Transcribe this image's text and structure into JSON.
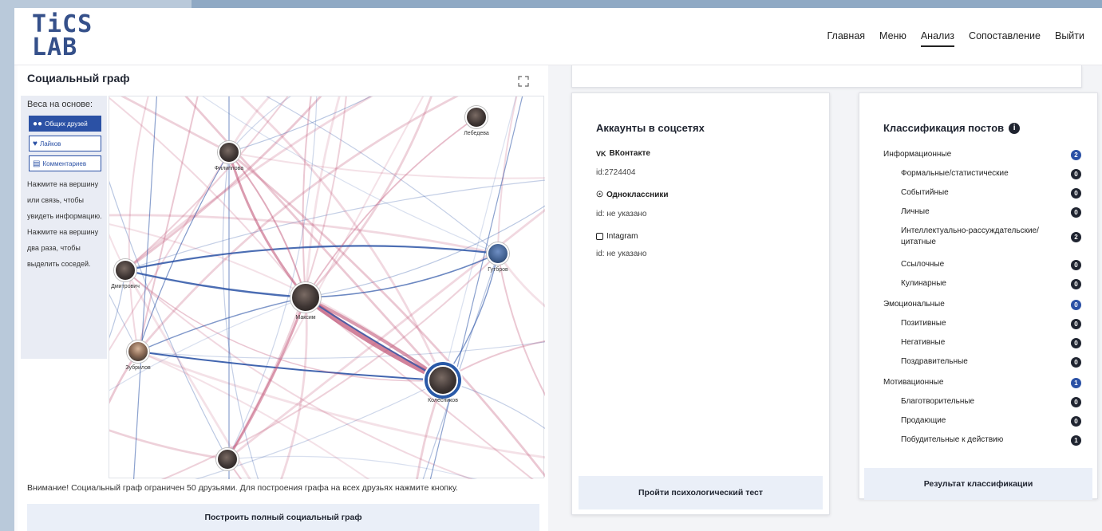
{
  "logo": {
    "line1": "TiCS",
    "line2": "LAB"
  },
  "nav": [
    "Главная",
    "Меню",
    "Анализ",
    "Сопоставление",
    "Выйти"
  ],
  "nav_active": "Анализ",
  "graph_panel": {
    "title": "Социальный граф",
    "weights_label": "Веса на основе:",
    "weight_buttons": [
      {
        "label": "Общих друзей",
        "icon": "users-icon",
        "active": true
      },
      {
        "label": "Лайков",
        "icon": "heart-icon",
        "active": false
      },
      {
        "label": "Комментариев",
        "icon": "comment-icon",
        "active": false
      }
    ],
    "hint": "Нажмите на вершину или связь, чтобы увидеть информацию. Нажмите на вершину два раза, чтобы выделить соседей.",
    "nodes": [
      "Лебедева",
      "Филиппова",
      "Гутбров",
      "Дмитрович",
      "Максим",
      "Зубрилов",
      "Колесников",
      ""
    ],
    "notice": "Внимание! Социальный граф ограничен 50 друзьями. Для построения графа на всех друзьях нажмите кнопку.",
    "build_button": "Построить полный социальный граф"
  },
  "accounts": {
    "title": "Аккаунты в соцсетях",
    "vk_label": "ВКонтакте",
    "vk_id": "id:2724404",
    "ok_label": "Одноклассники",
    "ok_id": "id: не указано",
    "ig_label": "Intagram",
    "ig_id": "id: не указано",
    "test_button": "Пройти психологический тест"
  },
  "classification": {
    "title": "Классификация постов",
    "info_icon": "i",
    "rows": [
      {
        "label": "Информационные",
        "count": "2",
        "sub": false,
        "accent": true
      },
      {
        "label": "Формальные/статистические",
        "count": "0",
        "sub": true
      },
      {
        "label": "Событийные",
        "count": "0",
        "sub": true
      },
      {
        "label": "Личные",
        "count": "0",
        "sub": true
      },
      {
        "label": "Интеллектуально-рассуждательские/ цитатные",
        "count": "2",
        "sub": true
      },
      {
        "label": "Ссылочные",
        "count": "0",
        "sub": true
      },
      {
        "label": "Кулинарные",
        "count": "0",
        "sub": true
      },
      {
        "label": "Эмоциональные",
        "count": "0",
        "sub": false,
        "accent": true
      },
      {
        "label": "Позитивные",
        "count": "0",
        "sub": true
      },
      {
        "label": "Негативные",
        "count": "0",
        "sub": true
      },
      {
        "label": "Поздравительные",
        "count": "0",
        "sub": true
      },
      {
        "label": "Мотивационные",
        "count": "1",
        "sub": false,
        "accent": true
      },
      {
        "label": "Благотворительные",
        "count": "0",
        "sub": true
      },
      {
        "label": "Продающие",
        "count": "0",
        "sub": true
      },
      {
        "label": "Побудительные к действию",
        "count": "1",
        "sub": true
      }
    ],
    "result_button": "Результат классификации"
  },
  "colors": {
    "accent": "#2b51a5",
    "edge_red": "#c2587a",
    "edge_blue": "#2c54a6"
  }
}
